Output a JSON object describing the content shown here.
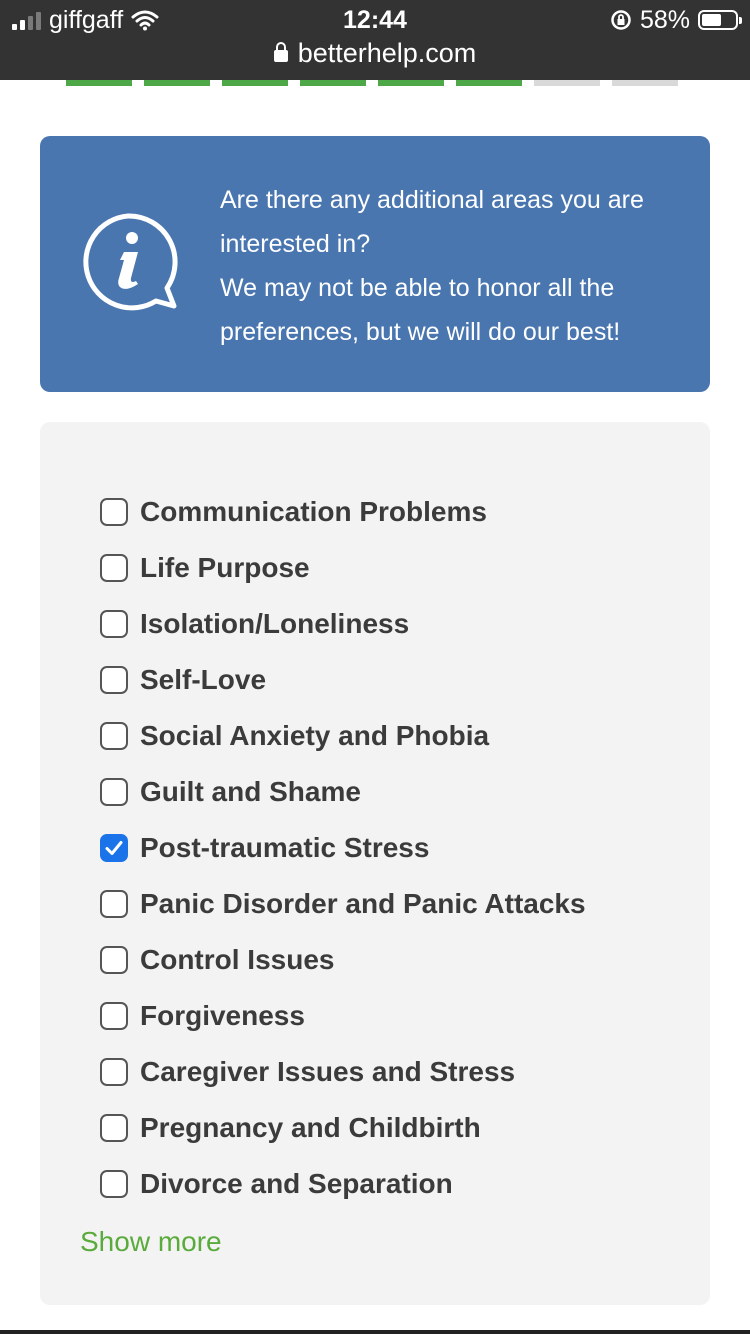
{
  "status": {
    "carrier": "giffgaff",
    "time": "12:44",
    "battery": "58%",
    "battery_level": 0.58,
    "url": "betterhelp.com"
  },
  "progress": {
    "total_steps": 8,
    "completed_steps": 6
  },
  "info": {
    "line1": "Are there any additional areas you are interested in?",
    "line2": "We may not be able to honor all the preferences, but we will do our best!"
  },
  "options": [
    {
      "label": "Communication Problems",
      "checked": false
    },
    {
      "label": "Life Purpose",
      "checked": false
    },
    {
      "label": "Isolation/Loneliness",
      "checked": false
    },
    {
      "label": "Self-Love",
      "checked": false
    },
    {
      "label": "Social Anxiety and Phobia",
      "checked": false
    },
    {
      "label": "Guilt and Shame",
      "checked": false
    },
    {
      "label": "Post-traumatic Stress",
      "checked": true
    },
    {
      "label": "Panic Disorder and Panic Attacks",
      "checked": false
    },
    {
      "label": "Control Issues",
      "checked": false
    },
    {
      "label": "Forgiveness",
      "checked": false
    },
    {
      "label": "Caregiver Issues and Stress",
      "checked": false
    },
    {
      "label": "Pregnancy and Childbirth",
      "checked": false
    },
    {
      "label": "Divorce and Separation",
      "checked": false
    }
  ],
  "show_more_label": "Show more",
  "colors": {
    "accent_blue": "#4a76b0",
    "progress_green": "#4fa847",
    "check_blue": "#1a73e8",
    "link_green": "#5aab3c"
  }
}
